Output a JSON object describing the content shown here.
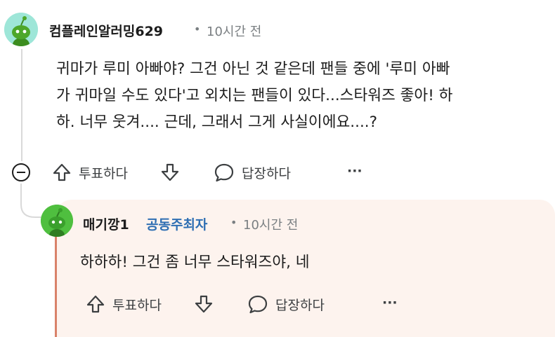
{
  "comment": {
    "username": "컴플레인알러밍629",
    "time": "10시간 전",
    "body_lines": [
      "귀마가 루미 아빠야? 그건 아닌 것 같은데 팬들 중에 '루미 아빠",
      "가 귀마일 수도 있다'고 외치는 팬들이 있다...스타워즈 좋아! 하",
      "하. 너무 웃겨.... 근데, 그래서 그게 사실이에요....?"
    ],
    "actions": {
      "vote_label": "투표하다",
      "reply_label": "답장하다",
      "more_label": "···"
    }
  },
  "reply": {
    "username": "매기깡1",
    "flair": "공동주최자",
    "time": "10시간 전",
    "body": "하하하! 그건 좀 너무 스타워즈야, 네",
    "actions": {
      "vote_label": "투표하다",
      "reply_label": "답장하다",
      "more_label": "···"
    }
  },
  "colors": {
    "flair": "#2f6fb3",
    "reply_background": "#fdf3ee",
    "meta_text": "#7a7f82"
  },
  "icons": [
    "snoo-avatar-icon",
    "collapse-thread-icon",
    "upvote-arrow-icon",
    "downvote-arrow-icon",
    "comment-bubble-icon",
    "more-options-icon"
  ]
}
